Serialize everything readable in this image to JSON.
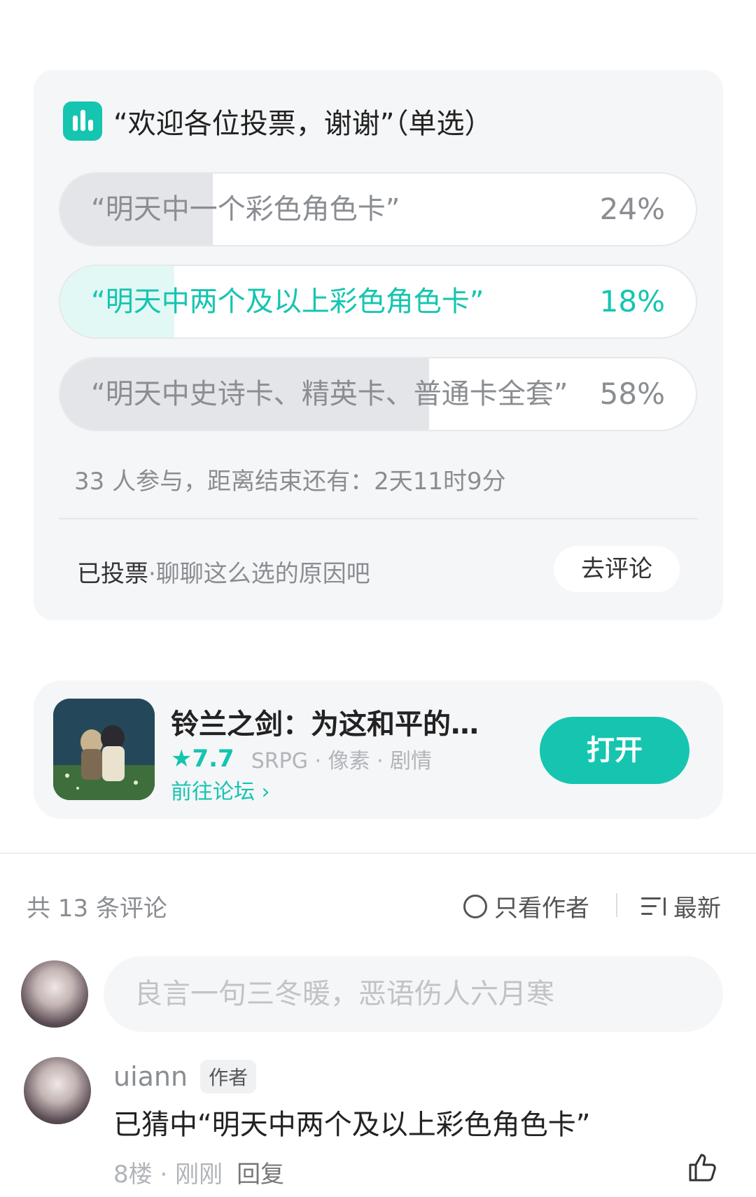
{
  "poll": {
    "title": "“欢迎各位投票，谢谢”（单选）",
    "options": [
      {
        "label": "“明天中一个彩色角色卡”",
        "percent": "24%",
        "share": 0.24,
        "selected": false
      },
      {
        "label": "“明天中两个及以上彩色角色卡”",
        "percent": "18%",
        "share": 0.18,
        "selected": true
      },
      {
        "label": "“明天中史诗卡、精英卡、普通卡全套”",
        "percent": "58%",
        "share": 0.58,
        "selected": false
      }
    ],
    "meta": "33 人参与，距离结束还有：2天11时9分",
    "voted_label": "已投票",
    "voted_prompt": "·聊聊这么选的原因吧",
    "comment_button": "去评论"
  },
  "app": {
    "name": "铃兰之剑：为这和平的…",
    "rating": "★7.7",
    "tags": "SRPG · 像素 · 剧情",
    "forum_link": "前往论坛 ›",
    "open_button": "打开"
  },
  "comments": {
    "count_label": "共 13 条评论",
    "author_only": "只看作者",
    "sort_label": "最新",
    "input_placeholder": "良言一句三冬暖，恶语伤人六月寒",
    "items": [
      {
        "user": "uiann",
        "badge": "作者",
        "text": "已猜中“明天中两个及以上彩色角色卡”",
        "floor": "8楼 · 刚刚",
        "reply": "回复"
      }
    ]
  },
  "colors": {
    "accent": "#15c5b0",
    "card_bg": "#f5f6f8",
    "muted_text": "#8a8d92"
  }
}
